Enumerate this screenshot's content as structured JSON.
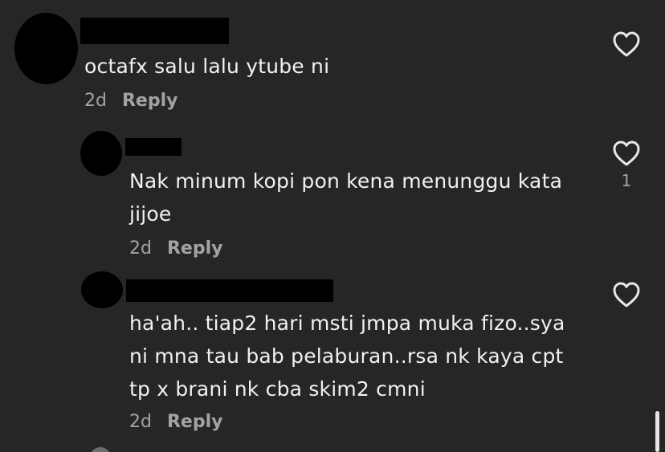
{
  "comments": [
    {
      "text_lines": [
        "octafx salu lalu ytube ni"
      ],
      "time": "2d",
      "reply_label": "Reply",
      "like_count": ""
    },
    {
      "text_lines": [
        "Nak minum kopi pon kena menunggu kata",
        "jijoe"
      ],
      "time": "2d",
      "reply_label": "Reply",
      "like_count": "1"
    },
    {
      "text_lines": [
        "ha'ah.. tiap2 hari msti jmpa muka fizo..sya",
        "ni mna tau bab pelaburan..rsa nk kaya cpt",
        "tp x brani nk cba skim2 cmni"
      ],
      "time": "2d",
      "reply_label": "Reply",
      "like_count": ""
    }
  ],
  "colors": {
    "background": "#262626",
    "text": "#f1f1f1",
    "meta": "#a3a3a3",
    "redaction": "#000000"
  },
  "icons": {
    "like": "heart-outline-icon"
  }
}
